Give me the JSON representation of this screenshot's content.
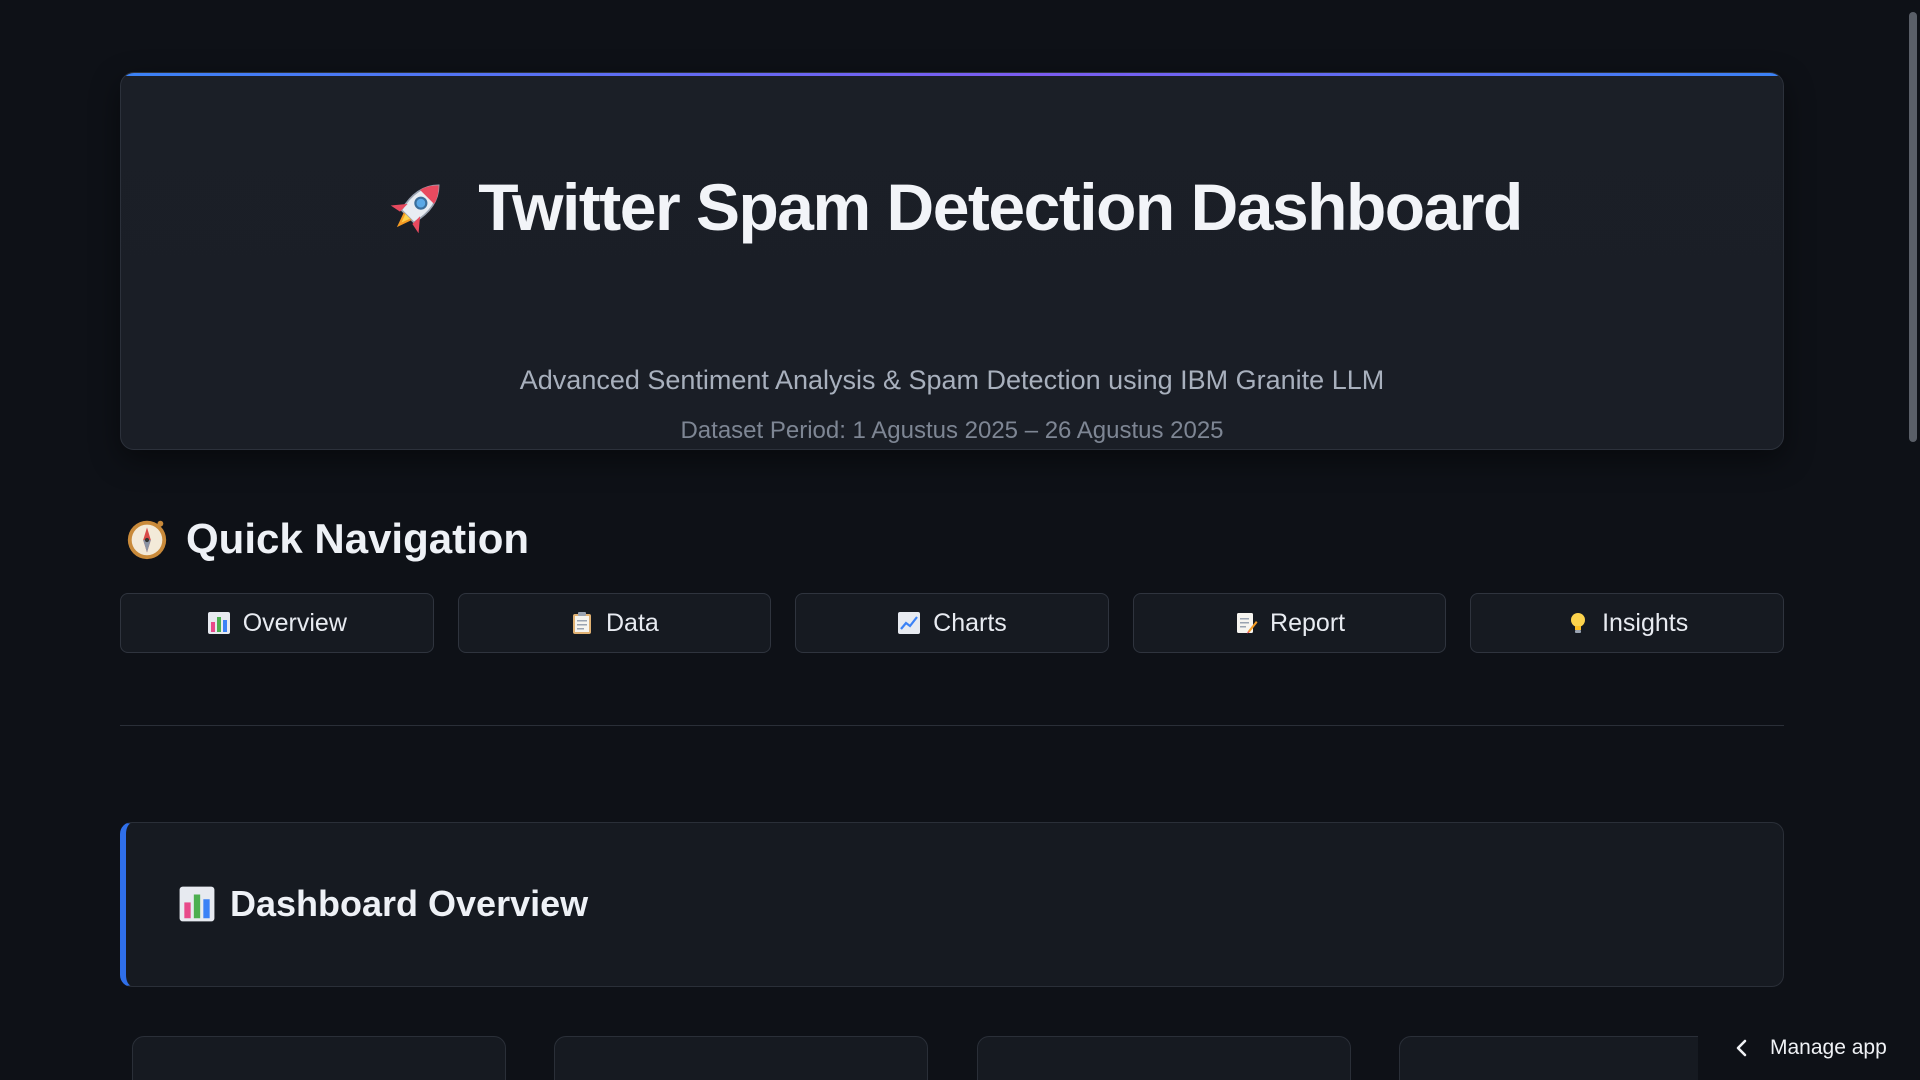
{
  "hero": {
    "title": "Twitter Spam Detection Dashboard",
    "icon": "rocket-icon",
    "subtitle": "Advanced Sentiment Analysis & Spam Detection using IBM Granite LLM",
    "period": "Dataset Period: 1 Agustus 2025 – 26 Agustus 2025",
    "accent_gradient": [
      "#3b82f6",
      "#7c5cf0"
    ]
  },
  "quick_nav": {
    "heading": "Quick Navigation",
    "icon": "compass-icon",
    "buttons": [
      {
        "label": "Overview",
        "icon": "bar-chart-icon"
      },
      {
        "label": "Data",
        "icon": "clipboard-icon"
      },
      {
        "label": "Charts",
        "icon": "chart-increasing-icon"
      },
      {
        "label": "Report",
        "icon": "memo-icon"
      },
      {
        "label": "Insights",
        "icon": "light-bulb-icon"
      }
    ]
  },
  "overview": {
    "title": "Dashboard Overview",
    "icon": "bar-chart-icon",
    "accent": "#2f6fea"
  },
  "footer": {
    "manage_app_label": "Manage app"
  },
  "colors": {
    "background": "#0e1117",
    "card": "#161a21",
    "border": "#2a2f38"
  }
}
